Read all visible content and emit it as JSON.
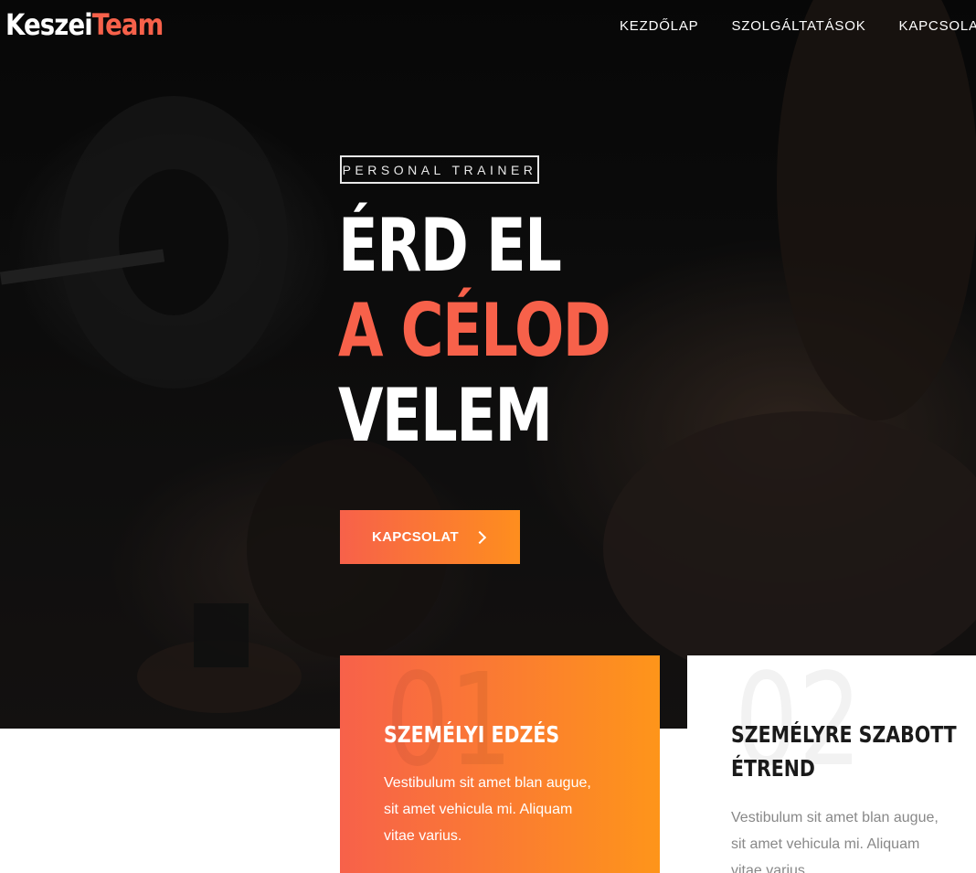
{
  "header": {
    "logo_part1": "Keszei",
    "logo_part2": "Team",
    "nav": [
      {
        "label": "KEZDŐLAP"
      },
      {
        "label": "SZOLGÁLTATÁSOK"
      },
      {
        "label": "KAPCSOLA"
      }
    ]
  },
  "hero": {
    "tag": "PERSONAL TRAINER",
    "headline_line1": "ÉRD EL",
    "headline_line2": "A CÉLOD",
    "headline_line3": "VELEM",
    "cta_label": "KAPCSOLAT",
    "cta_icon": "chevron-right-icon"
  },
  "services": [
    {
      "number": "01",
      "title_line1": "SZEMÉLYI EDZÉS",
      "title_line2": "",
      "text": "Vestibulum sit amet blan augue, sit amet vehicula mi. Aliquam vitae varius."
    },
    {
      "number": "02",
      "title_line1": "SZEMÉLYRE SZABOTT",
      "title_line2": "ÉTREND",
      "text": "Vestibulum sit amet blan augue, sit amet vehicula mi. Aliquam vitae varius."
    }
  ],
  "colors": {
    "accent": "#f7614a",
    "accent_end": "#fe8e1e",
    "dark": "#0a0a0a"
  }
}
